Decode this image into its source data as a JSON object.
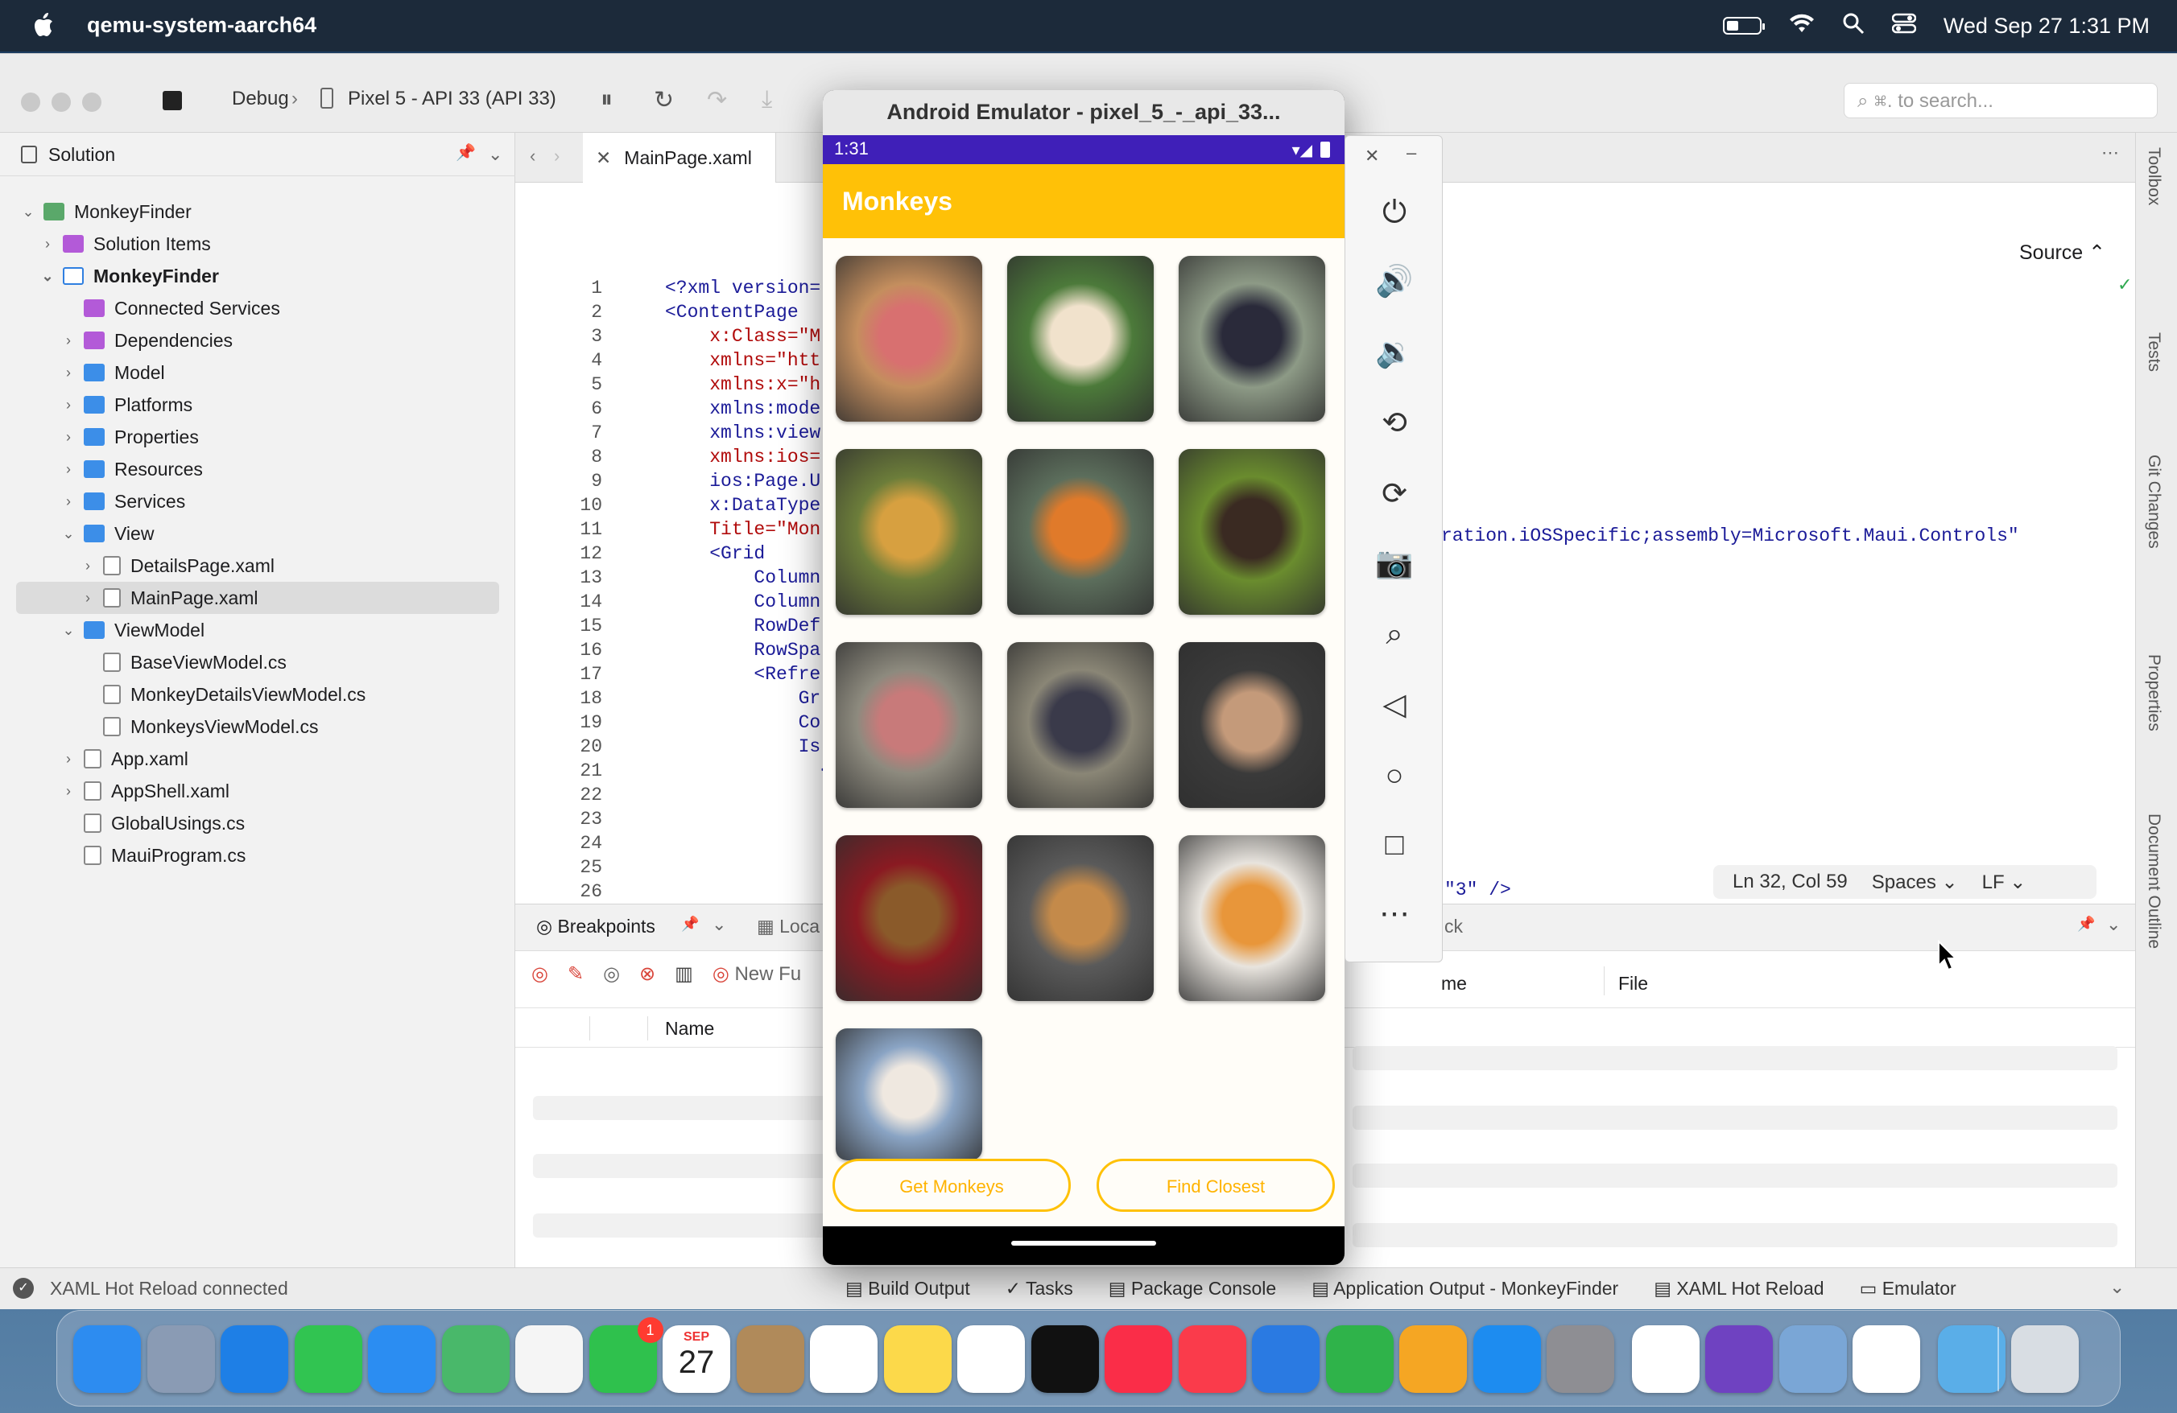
{
  "menubar": {
    "app_name": "qemu-system-aarch64",
    "datetime": "Wed Sep 27  1:31 PM"
  },
  "toolbar": {
    "config": "Debug",
    "device": "Pixel 5 - API 33 (API 33)",
    "search_placeholder": "⌘. to search..."
  },
  "solution": {
    "title": "Solution",
    "items": [
      {
        "label": "MonkeyFinder",
        "icon": "solution-icon",
        "expanded": true
      },
      {
        "label": "Solution Items",
        "icon": "folder-purple-icon"
      },
      {
        "label": "MonkeyFinder",
        "icon": "project-icon",
        "expanded": true
      },
      {
        "label": "Connected Services",
        "icon": "connected-services-icon"
      },
      {
        "label": "Dependencies",
        "icon": "dependencies-icon"
      },
      {
        "label": "Model",
        "icon": "folder-icon"
      },
      {
        "label": "Platforms",
        "icon": "folder-icon"
      },
      {
        "label": "Properties",
        "icon": "folder-icon"
      },
      {
        "label": "Resources",
        "icon": "folder-icon"
      },
      {
        "label": "Services",
        "icon": "folder-icon"
      },
      {
        "label": "View",
        "icon": "folder-icon",
        "expanded": true
      },
      {
        "label": "DetailsPage.xaml",
        "icon": "xaml-file-icon"
      },
      {
        "label": "MainPage.xaml",
        "icon": "xaml-file-icon",
        "selected": true
      },
      {
        "label": "ViewModel",
        "icon": "folder-icon",
        "expanded": true
      },
      {
        "label": "BaseViewModel.cs",
        "icon": "cs-file-icon"
      },
      {
        "label": "MonkeyDetailsViewModel.cs",
        "icon": "cs-file-icon"
      },
      {
        "label": "MonkeysViewModel.cs",
        "icon": "cs-file-icon"
      },
      {
        "label": "App.xaml",
        "icon": "xaml-file-icon"
      },
      {
        "label": "AppShell.xaml",
        "icon": "xaml-file-icon"
      },
      {
        "label": "GlobalUsings.cs",
        "icon": "cs-file-icon"
      },
      {
        "label": "MauiProgram.cs",
        "icon": "cs-file-icon"
      }
    ]
  },
  "editor": {
    "tab_label": "MainPage.xaml",
    "source_label": "Source",
    "lines": [
      "1",
      "2",
      "3",
      "4",
      "5",
      "6",
      "7",
      "8",
      "9",
      "10",
      "11",
      "12",
      "13",
      "14",
      "15",
      "16",
      "17",
      "18",
      "19",
      "20",
      "21",
      "22",
      "23",
      "24",
      "25",
      "26"
    ],
    "code": [
      "<?xml version=",
      "<ContentPage",
      "    x:Class=\"M",
      "    xmlns=\"htt",
      "    xmlns:x=\"h",
      "    xmlns:mode",
      "    xmlns:view",
      "    xmlns:ios=",
      "    ios:Page.U",
      "    x:DataType",
      "    Title=\"Mon",
      "    <Grid",
      "        Column",
      "        Column",
      "        RowDef",
      "        RowSpa",
      "        <Refre",
      "            Gr",
      "            Co",
      "            Is",
      "              <",
      "",
      "",
      "",
      "",
      ""
    ],
    "right_code_line8": "ration.iOSSpecific;assembly=Microsoft.Maui.Controls\"",
    "right_code_line26": "\"3\" />",
    "position": "Ln 32, Col 59",
    "indent": "Spaces",
    "line_ending": "LF"
  },
  "bottom": {
    "breakpoints_tab": "Breakpoints",
    "locals_tab": "Loca",
    "new_function": "New Fu",
    "name_col": "Name",
    "callstack_tab": "ck",
    "name_col_right": "me",
    "file_col": "File"
  },
  "statusbar": {
    "left": "XAML Hot Reload connected",
    "tabs": [
      "Build Output",
      "Tasks",
      "Package Console",
      "Application Output - MonkeyFinder",
      "XAML Hot Reload",
      "Emulator"
    ]
  },
  "sidestrip": {
    "tabs": [
      "Toolbox",
      "Tests",
      "Git Changes",
      "Properties",
      "Document Outline"
    ]
  },
  "emulator": {
    "title": "Android Emulator - pixel_5_-_api_33...",
    "time": "1:31",
    "app_title": "Monkeys",
    "buttons": [
      "Get Monkeys",
      "Find Closest"
    ],
    "thumbs": [
      {
        "color": "#c48e5e",
        "face": "#d87070"
      },
      {
        "color": "#4c7a3a",
        "face": "#f1e2cc"
      },
      {
        "color": "#8d9a86",
        "face": "#2a2a3a"
      },
      {
        "color": "#6c7d3a",
        "face": "#d7a040"
      },
      {
        "color": "#5c6e5c",
        "face": "#e07a2a"
      },
      {
        "color": "#6a8c2e",
        "face": "#3a2a22"
      },
      {
        "color": "#8d8a7e",
        "face": "#c87a7a"
      },
      {
        "color": "#8a8676",
        "face": "#3a3a4a"
      },
      {
        "color": "#3a3a3a",
        "face": "#c49a7a"
      },
      {
        "color": "#8a1a22",
        "face": "#8a5a2a"
      },
      {
        "color": "#5a5a5a",
        "face": "#c48a4a"
      },
      {
        "color": "#e8e4de",
        "face": "#e8963a"
      },
      {
        "color": "#8aa4c4",
        "face": "#efe8e0"
      }
    ]
  },
  "dock": {
    "calendar_month": "SEP",
    "calendar_day": "27",
    "facetime_badge": "1",
    "apps": [
      {
        "name": "finder-icon",
        "color": "#2d8cf0"
      },
      {
        "name": "launchpad-icon",
        "color": "#8a9bb4"
      },
      {
        "name": "safari-icon",
        "color": "#1e7fe6"
      },
      {
        "name": "messages-icon",
        "color": "#31c451"
      },
      {
        "name": "mail-icon",
        "color": "#2b8df2"
      },
      {
        "name": "maps-icon",
        "color": "#49b86a"
      },
      {
        "name": "photos-icon",
        "color": "#f5f5f5"
      },
      {
        "name": "facetime-icon",
        "color": "#2fc14d"
      },
      {
        "name": "calendar-icon",
        "color": "#ffffff"
      },
      {
        "name": "contacts-icon",
        "color": "#b08a5a"
      },
      {
        "name": "reminders-icon",
        "color": "#ffffff"
      },
      {
        "name": "notes-icon",
        "color": "#fcd94a"
      },
      {
        "name": "freeform-icon",
        "color": "#ffffff"
      },
      {
        "name": "tv-icon",
        "color": "#111111"
      },
      {
        "name": "music-icon",
        "color": "#fa2d48"
      },
      {
        "name": "news-icon",
        "color": "#fa3b4b"
      },
      {
        "name": "keynote-icon",
        "color": "#2a7ae2"
      },
      {
        "name": "numbers-icon",
        "color": "#2fb34a"
      },
      {
        "name": "pages-icon",
        "color": "#f5a623"
      },
      {
        "name": "app-store-icon",
        "color": "#1d8cf0"
      },
      {
        "name": "system-settings-icon",
        "color": "#8e8e93"
      },
      {
        "name": "chrome-icon",
        "color": "#ffffff"
      },
      {
        "name": "visual-studio-icon",
        "color": "#6f42c1"
      },
      {
        "name": "preview-icon",
        "color": "#7aa6d6"
      },
      {
        "name": "simulator-icon",
        "color": "#ffffff"
      },
      {
        "name": "downloads-folder-icon",
        "color": "#5aaee8"
      },
      {
        "name": "trash-icon",
        "color": "#d8dde3"
      }
    ]
  }
}
